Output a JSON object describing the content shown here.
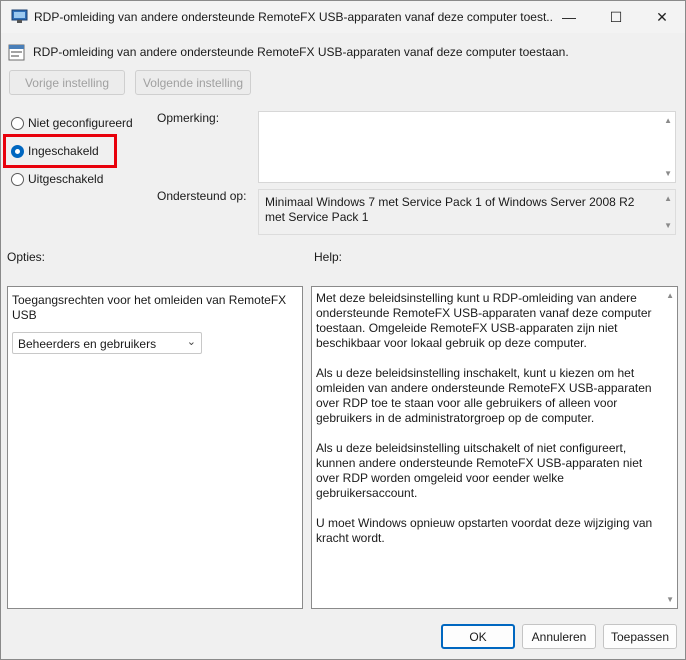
{
  "window": {
    "title": "RDP-omleiding van andere ondersteunde RemoteFX USB-apparaten vanaf deze computer toest...",
    "minimize": "—",
    "maximize": "☐",
    "close": "✕"
  },
  "policy": {
    "title": "RDP-omleiding van andere ondersteunde RemoteFX USB-apparaten vanaf deze computer toestaan."
  },
  "nav": {
    "previous": "Vorige instelling",
    "next": "Volgende instelling"
  },
  "state": {
    "options": [
      {
        "label": "Niet geconfigureerd",
        "selected": false
      },
      {
        "label": "Ingeschakeld",
        "selected": true
      },
      {
        "label": "Uitgeschakeld",
        "selected": false
      }
    ]
  },
  "labels": {
    "comment": "Opmerking:",
    "supported": "Ondersteund op:",
    "options": "Opties:",
    "help": "Help:"
  },
  "supported_on": "Minimaal Windows 7 met Service Pack 1 of Windows Server 2008 R2 met Service Pack 1",
  "options_panel": {
    "label": "Toegangsrechten voor het omleiden van RemoteFX USB",
    "select_value": "Beheerders en gebruikers"
  },
  "help": {
    "paragraphs": [
      "Met deze beleidsinstelling kunt u RDP-omleiding van andere ondersteunde RemoteFX USB-apparaten vanaf deze computer toestaan. Omgeleide RemoteFX USB-apparaten zijn niet beschikbaar voor lokaal gebruik op deze computer.",
      "Als u deze beleidsinstelling inschakelt, kunt u kiezen om het omleiden van andere ondersteunde RemoteFX USB-apparaten over RDP toe te staan voor alle gebruikers of alleen voor gebruikers in de administratorgroep op de computer.",
      "Als u deze beleidsinstelling uitschakelt of niet configureert, kunnen andere ondersteunde RemoteFX USB-apparaten niet over RDP worden omgeleid voor eender welke gebruikersaccount.",
      "U moet Windows opnieuw opstarten voordat deze wijziging van kracht wordt."
    ]
  },
  "buttons": {
    "ok": "OK",
    "cancel": "Annuleren",
    "apply": "Toepassen"
  },
  "colors": {
    "accent": "#0067c0",
    "highlight": "#e8000b"
  }
}
